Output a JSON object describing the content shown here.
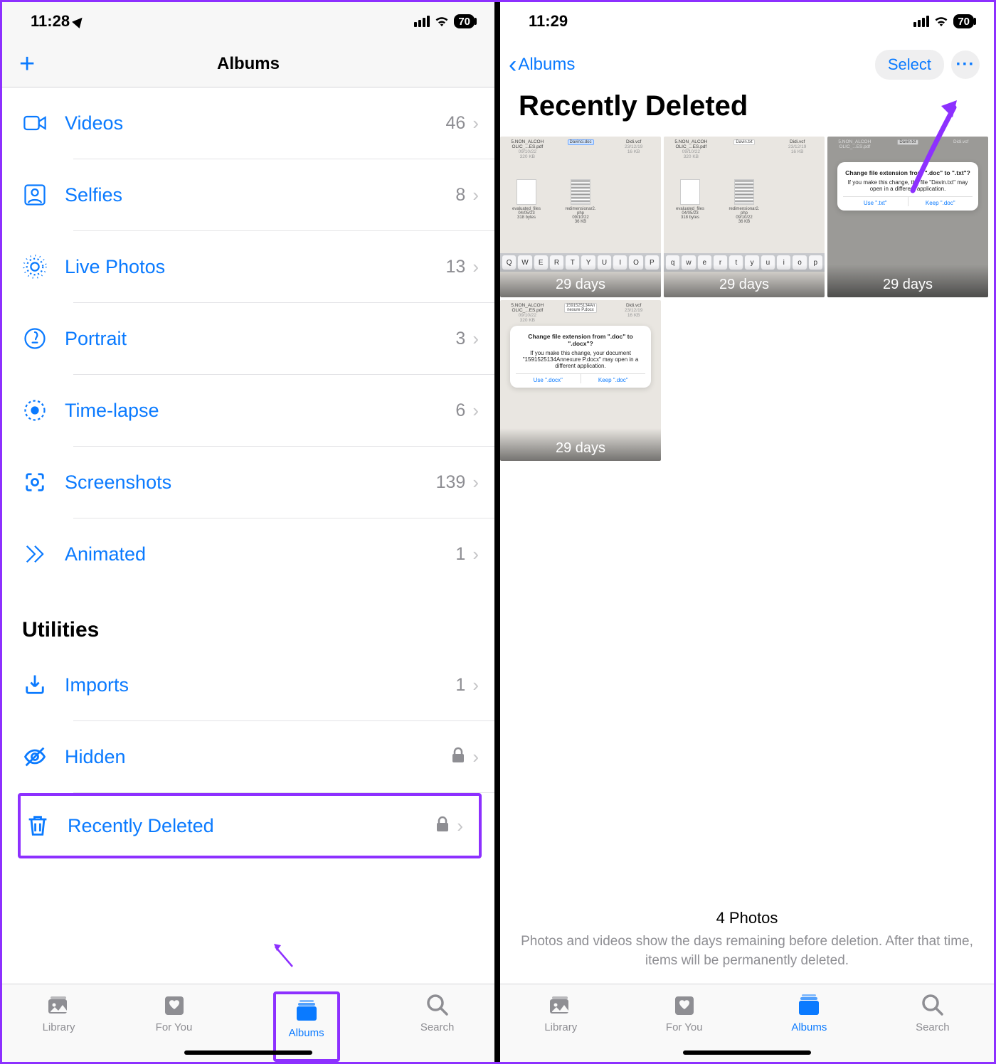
{
  "left": {
    "status": {
      "time": "11:28",
      "battery": "70"
    },
    "header": {
      "title": "Albums"
    },
    "mediaTypes": [
      {
        "icon": "video-icon",
        "label": "Videos",
        "count": "46"
      },
      {
        "icon": "selfie-icon",
        "label": "Selfies",
        "count": "8"
      },
      {
        "icon": "livephoto-icon",
        "label": "Live Photos",
        "count": "13"
      },
      {
        "icon": "portrait-icon",
        "label": "Portrait",
        "count": "3"
      },
      {
        "icon": "timelapse-icon",
        "label": "Time-lapse",
        "count": "6"
      },
      {
        "icon": "screenshot-icon",
        "label": "Screenshots",
        "count": "139"
      },
      {
        "icon": "animated-icon",
        "label": "Animated",
        "count": "1"
      }
    ],
    "utilitiesTitle": "Utilities",
    "utilities": [
      {
        "icon": "imports-icon",
        "label": "Imports",
        "count": "1",
        "locked": false
      },
      {
        "icon": "hidden-icon",
        "label": "Hidden",
        "count": "",
        "locked": true
      },
      {
        "icon": "trash-icon",
        "label": "Recently Deleted",
        "count": "",
        "locked": true
      }
    ]
  },
  "right": {
    "status": {
      "time": "11:29",
      "battery": "70"
    },
    "back": "Albums",
    "select": "Select",
    "title": "Recently Deleted",
    "thumbs": [
      {
        "days": "29 days",
        "dialog": null
      },
      {
        "days": "29 days",
        "dialog": null
      },
      {
        "days": "29 days",
        "dialog": {
          "title": "Change file extension from \".doc\" to \".txt\"?",
          "body": "If you make this change, the file \"Davin.txt\" may open in a different application.",
          "btn1": "Use \".txt\"",
          "btn2": "Keep \".doc\""
        }
      },
      {
        "days": "29 days",
        "dialog": {
          "title": "Change file extension from \".doc\" to \".docx\"?",
          "body": "If you make this change, your document \"1591525134Annexure P.docx\" may open in a different application.",
          "btn1": "Use \".docx\"",
          "btn2": "Keep \".doc\""
        }
      }
    ],
    "footer": {
      "count": "4 Photos",
      "sub": "Photos and videos show the days remaining before deletion. After that time, items will be permanently deleted."
    }
  },
  "tabs": [
    {
      "label": "Library"
    },
    {
      "label": "For You"
    },
    {
      "label": "Albums"
    },
    {
      "label": "Search"
    }
  ]
}
